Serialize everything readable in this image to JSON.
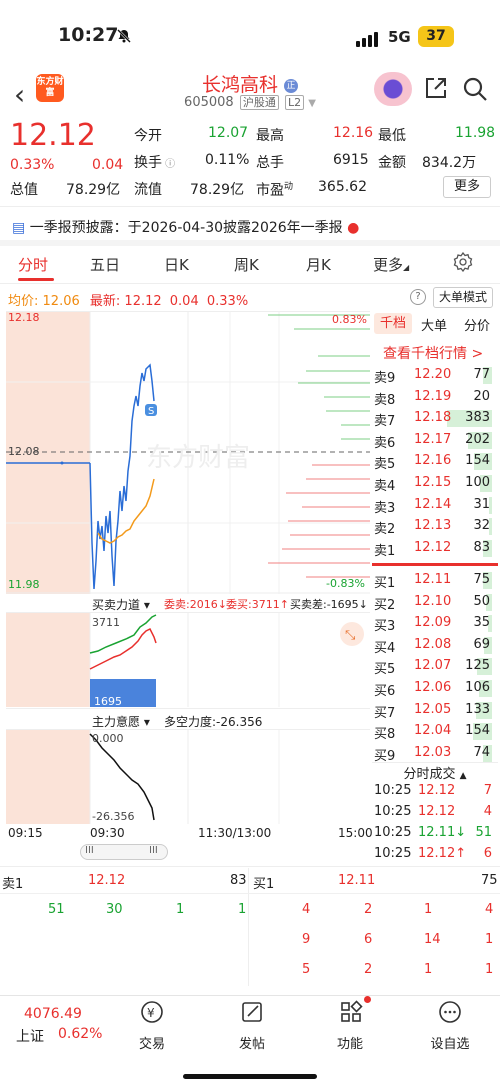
{
  "status": {
    "time": "10:27",
    "network": "5G",
    "battery": "37"
  },
  "header": {
    "logo_text": "东方财富",
    "title": "长鸿高科",
    "title_badge": "正",
    "code": "605008",
    "tag1": "沪股通",
    "tag2": "L2"
  },
  "quote": {
    "price": "12.12",
    "change_pct": "0.33%",
    "change": "0.04",
    "open_label": "今开",
    "open": "12.07",
    "high_label": "最高",
    "high": "12.16",
    "low_label": "最低",
    "low": "11.98",
    "turnover_label": "换手",
    "turnover": "0.11%",
    "volume_label": "总手",
    "volume": "6915",
    "amount_label": "金额",
    "amount": "834.2万",
    "mcap_label": "总值",
    "mcap": "78.29亿",
    "float_label": "流值",
    "float_cap": "78.29亿",
    "pe_label": "市盈",
    "pe_sup": "动",
    "pe": "365.62",
    "more": "更多"
  },
  "announcement": "一季报预披露：于2026-04-30披露2026年一季报",
  "tabs": [
    "分时",
    "五日",
    "日K",
    "周K",
    "月K",
    "更多"
  ],
  "intraday": {
    "avg_label": "均价:",
    "avg": "12.06",
    "last_label": "最新:",
    "last": "12.12",
    "chg": "0.04",
    "pct": "0.33%",
    "big_order": "大单模式",
    "y_top": "12.18",
    "y_mid": "12.08",
    "y_bottom": "11.98",
    "pct_top": "0.83%",
    "pct_bottom": "-0.83%",
    "flag": "S",
    "times": [
      "09:15",
      "09:30",
      "11:30/13:00",
      "15:00"
    ],
    "watermark": "东方财富"
  },
  "power": {
    "title": "买卖力道",
    "sell_committee": "委卖:2016",
    "buy_committee": "委买:3711",
    "diff": "买卖差:-1695",
    "val1": "3711",
    "val2": "1695"
  },
  "intent": {
    "title": "主力意愿",
    "strength": "多空力度:-26.356",
    "top": "0.000",
    "bottom": "-26.356"
  },
  "orderbook": {
    "tabs": [
      "千档",
      "大单",
      "分价"
    ],
    "link": "查看千档行情 >",
    "asks": [
      {
        "label": "卖9",
        "price": "12.20",
        "vol": "77",
        "bar": 0.15
      },
      {
        "label": "卖8",
        "price": "12.19",
        "vol": "20",
        "bar": 0.0
      },
      {
        "label": "卖7",
        "price": "12.18",
        "vol": "383",
        "bar": 0.75
      },
      {
        "label": "卖6",
        "price": "12.17",
        "vol": "202",
        "bar": 0.4
      },
      {
        "label": "卖5",
        "price": "12.16",
        "vol": "154",
        "bar": 0.3
      },
      {
        "label": "卖4",
        "price": "12.15",
        "vol": "100",
        "bar": 0.2
      },
      {
        "label": "卖3",
        "price": "12.14",
        "vol": "31",
        "bar": 0.05
      },
      {
        "label": "卖2",
        "price": "12.13",
        "vol": "32",
        "bar": 0.05
      },
      {
        "label": "卖1",
        "price": "12.12",
        "vol": "83",
        "bar": 0.15
      }
    ],
    "bids": [
      {
        "label": "买1",
        "price": "12.11",
        "vol": "75",
        "bar": 0.15
      },
      {
        "label": "买2",
        "price": "12.10",
        "vol": "50",
        "bar": 0.1
      },
      {
        "label": "买3",
        "price": "12.09",
        "vol": "35",
        "bar": 0.07
      },
      {
        "label": "买4",
        "price": "12.08",
        "vol": "69",
        "bar": 0.14
      },
      {
        "label": "买5",
        "price": "12.07",
        "vol": "125",
        "bar": 0.25
      },
      {
        "label": "买6",
        "price": "12.06",
        "vol": "106",
        "bar": 0.21
      },
      {
        "label": "买7",
        "price": "12.05",
        "vol": "133",
        "bar": 0.27
      },
      {
        "label": "买8",
        "price": "12.04",
        "vol": "154",
        "bar": 0.31
      },
      {
        "label": "买9",
        "price": "12.03",
        "vol": "74",
        "bar": 0.15
      }
    ]
  },
  "trades": {
    "title": "分时成交",
    "rows": [
      {
        "time": "10:25",
        "price": "12.12",
        "vol": "7",
        "dir": ""
      },
      {
        "time": "10:25",
        "price": "12.12",
        "vol": "4",
        "dir": ""
      },
      {
        "time": "10:25",
        "price": "12.11↓",
        "vol": "51",
        "dir": "down"
      },
      {
        "time": "10:25",
        "price": "12.12↑",
        "vol": "6",
        "dir": "up"
      }
    ]
  },
  "bottom_book": {
    "ask_label": "卖1",
    "ask_price": "12.12",
    "ask_vol": "83",
    "bid_label": "买1",
    "bid_price": "12.11",
    "bid_vol": "75",
    "ask_queue": [
      "51",
      "30",
      "1",
      "1"
    ],
    "bid_queue": [
      [
        "4",
        "2",
        "1",
        "4"
      ],
      [
        "9",
        "6",
        "14",
        "1"
      ],
      [
        "5",
        "2",
        "1",
        "1"
      ]
    ]
  },
  "nav": {
    "index_value": "4076.49",
    "index_name": "上证",
    "index_pct": "0.62%",
    "items": [
      "交易",
      "发帖",
      "功能",
      "设自选"
    ]
  }
}
